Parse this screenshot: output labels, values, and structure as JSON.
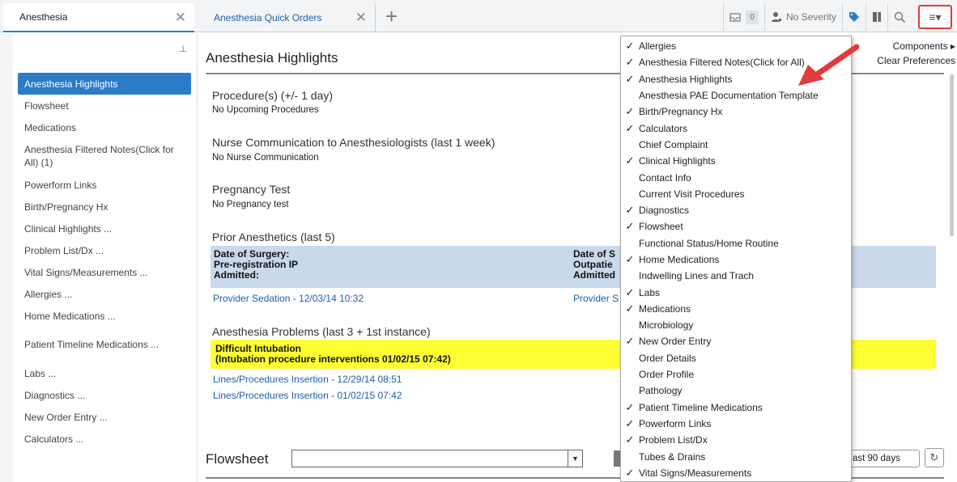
{
  "tabs": [
    {
      "label": "Anesthesia",
      "close": "✕"
    },
    {
      "label": "Anesthesia Quick Orders",
      "close": "✕"
    }
  ],
  "add_tab": "+",
  "toolbar": {
    "inbox_count": "0",
    "severity_label": "No Severity"
  },
  "menu_button_label": "≡▾",
  "sidebar": {
    "pin": "⊥",
    "items": [
      {
        "label": "Anesthesia Highlights"
      },
      {
        "label": "Flowsheet"
      },
      {
        "label": "Medications"
      },
      {
        "label": "Anesthesia Filtered Notes(Click for All) (1)"
      },
      {
        "label": "Powerform Links"
      },
      {
        "label": "Birth/Pregnancy Hx"
      },
      {
        "label": "Clinical Highlights ..."
      },
      {
        "label": "Problem List/Dx ..."
      },
      {
        "label": "Vital Signs/Measurements ..."
      },
      {
        "label": "Allergies ..."
      },
      {
        "label": "Home Medications ..."
      },
      {
        "label": "Patient Timeline Medications ..."
      },
      {
        "label": "Labs ..."
      },
      {
        "label": "Diagnostics ..."
      },
      {
        "label": "New Order Entry ..."
      },
      {
        "label": "Calculators ..."
      }
    ]
  },
  "main": {
    "title": "Anesthesia Highlights",
    "procedures": {
      "title": "Procedure(s) (+/- 1 day)",
      "value": "No Upcoming Procedures"
    },
    "nurse": {
      "title": "Nurse Communication to Anesthesiologists (last 1 week)",
      "value": "No Nurse Communication"
    },
    "pregnancy": {
      "title": "Pregnancy Test",
      "value": "No Pregnancy test"
    },
    "prior": {
      "title": "Prior Anesthetics (last 5)",
      "col1": [
        "Date of Surgery:",
        "Pre-registration IP",
        "Admitted:"
      ],
      "col2": [
        "Date of S",
        "Outpatie",
        "Admitted"
      ],
      "link1": "Provider Sedation - 12/03/14 10:32",
      "link2": "Provider S"
    },
    "problems": {
      "title": "Anesthesia Problems (last 3 + 1st instance)",
      "line1": "Difficult Intubation",
      "line2": "(Intubation procedure interventions 01/02/15 07:42)",
      "links": [
        "Lines/Procedures Insertion - 12/29/14 08:51",
        "Lines/Procedures Insertion - 01/02/15 07:42"
      ]
    },
    "flowsheet": {
      "title": "Flowsheet",
      "range": "ast 90 days",
      "refresh": "↻"
    }
  },
  "submenu": {
    "components": "Components ▸",
    "clear": "Clear Preferences"
  },
  "dropdown": [
    {
      "label": "Allergies",
      "check": "✓"
    },
    {
      "label": "Anesthesia Filtered Notes(Click for All)",
      "check": "✓"
    },
    {
      "label": "Anesthesia Highlights",
      "check": "✓"
    },
    {
      "label": "Anesthesia PAE Documentation Template",
      "check": ""
    },
    {
      "label": "Birth/Pregnancy Hx",
      "check": "✓"
    },
    {
      "label": "Calculators",
      "check": "✓"
    },
    {
      "label": "Chief Complaint",
      "check": ""
    },
    {
      "label": "Clinical Highlights",
      "check": "✓"
    },
    {
      "label": "Contact Info",
      "check": ""
    },
    {
      "label": "Current Visit Procedures",
      "check": ""
    },
    {
      "label": "Diagnostics",
      "check": "✓"
    },
    {
      "label": "Flowsheet",
      "check": "✓"
    },
    {
      "label": "Functional Status/Home Routine",
      "check": ""
    },
    {
      "label": "Home Medications",
      "check": "✓"
    },
    {
      "label": "Indwelling Lines and Trach",
      "check": ""
    },
    {
      "label": "Labs",
      "check": "✓"
    },
    {
      "label": "Medications",
      "check": "✓"
    },
    {
      "label": "Microbiology",
      "check": ""
    },
    {
      "label": "New Order Entry",
      "check": "✓"
    },
    {
      "label": "Order Details",
      "check": ""
    },
    {
      "label": "Order Profile",
      "check": ""
    },
    {
      "label": "Pathology",
      "check": ""
    },
    {
      "label": "Patient Timeline Medications",
      "check": "✓"
    },
    {
      "label": "Powerform Links",
      "check": "✓"
    },
    {
      "label": "Problem List/Dx",
      "check": "✓"
    },
    {
      "label": "Tubes & Drains",
      "check": ""
    },
    {
      "label": "Vital Signs/Measurements",
      "check": "✓"
    }
  ],
  "colors": {
    "accent": "#2a7cc7",
    "highlight": "#ffff33",
    "band": "#c9d9ec",
    "annotation": "#e03b3b"
  }
}
